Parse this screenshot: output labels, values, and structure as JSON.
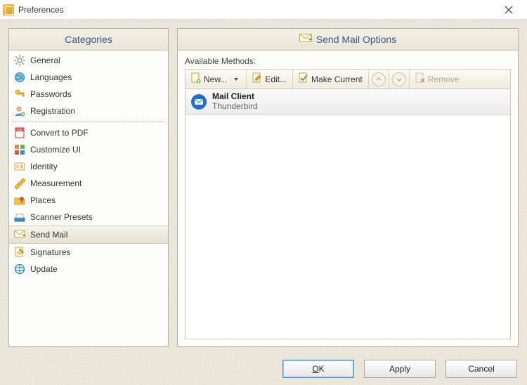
{
  "window": {
    "title": "Preferences"
  },
  "left": {
    "header": "Categories",
    "items": [
      {
        "label": "General",
        "icon": "gear-icon"
      },
      {
        "label": "Languages",
        "icon": "globe-icon"
      },
      {
        "label": "Passwords",
        "icon": "key-icon"
      },
      {
        "label": "Registration",
        "icon": "user-add-icon"
      },
      {
        "sep": true
      },
      {
        "label": "Convert to PDF",
        "icon": "pdf-icon"
      },
      {
        "label": "Customize UI",
        "icon": "squares-icon"
      },
      {
        "label": "Identity",
        "icon": "id-card-icon"
      },
      {
        "label": "Measurement",
        "icon": "ruler-icon"
      },
      {
        "label": "Places",
        "icon": "folder-pin-icon"
      },
      {
        "label": "Scanner Presets",
        "icon": "scanner-icon"
      },
      {
        "label": "Send Mail",
        "icon": "mail-icon",
        "selected": true
      },
      {
        "label": "Signatures",
        "icon": "signature-icon"
      },
      {
        "label": "Update",
        "icon": "update-icon"
      }
    ]
  },
  "right": {
    "header": "Send Mail Options",
    "available_label": "Available Methods:",
    "toolbar": {
      "new_label": "New...",
      "edit_label": "Edit...",
      "make_current_label": "Make Current",
      "remove_label": "Remove"
    },
    "methods": [
      {
        "title": "Mail Client",
        "subtitle": "Thunderbird",
        "icon": "thunderbird-icon"
      }
    ]
  },
  "footer": {
    "ok": "OK",
    "apply": "Apply",
    "cancel": "Cancel"
  }
}
